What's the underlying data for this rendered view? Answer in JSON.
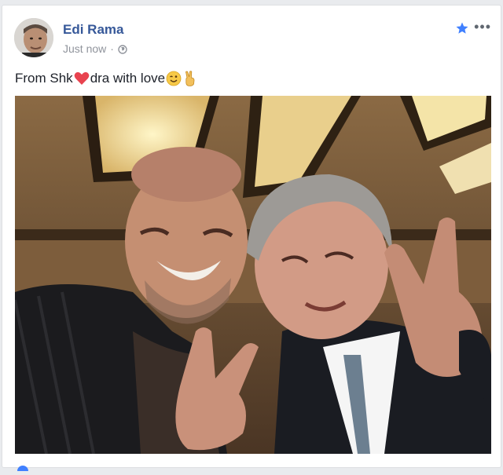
{
  "post": {
    "author_name": "Edi Rama",
    "timestamp": "Just now",
    "separator": "·",
    "privacy_icon": "globe-icon",
    "text_before": "From Shk",
    "text_after": "dra with love",
    "icons": [
      "heart-emoji-icon",
      "wink-emoji-icon",
      "victory-hand-emoji-icon",
      "star-icon",
      "more-options-icon"
    ]
  },
  "colors": {
    "author": "#365899",
    "meta": "#90949c",
    "star": "#4080ff",
    "heart": "#e8434f"
  }
}
